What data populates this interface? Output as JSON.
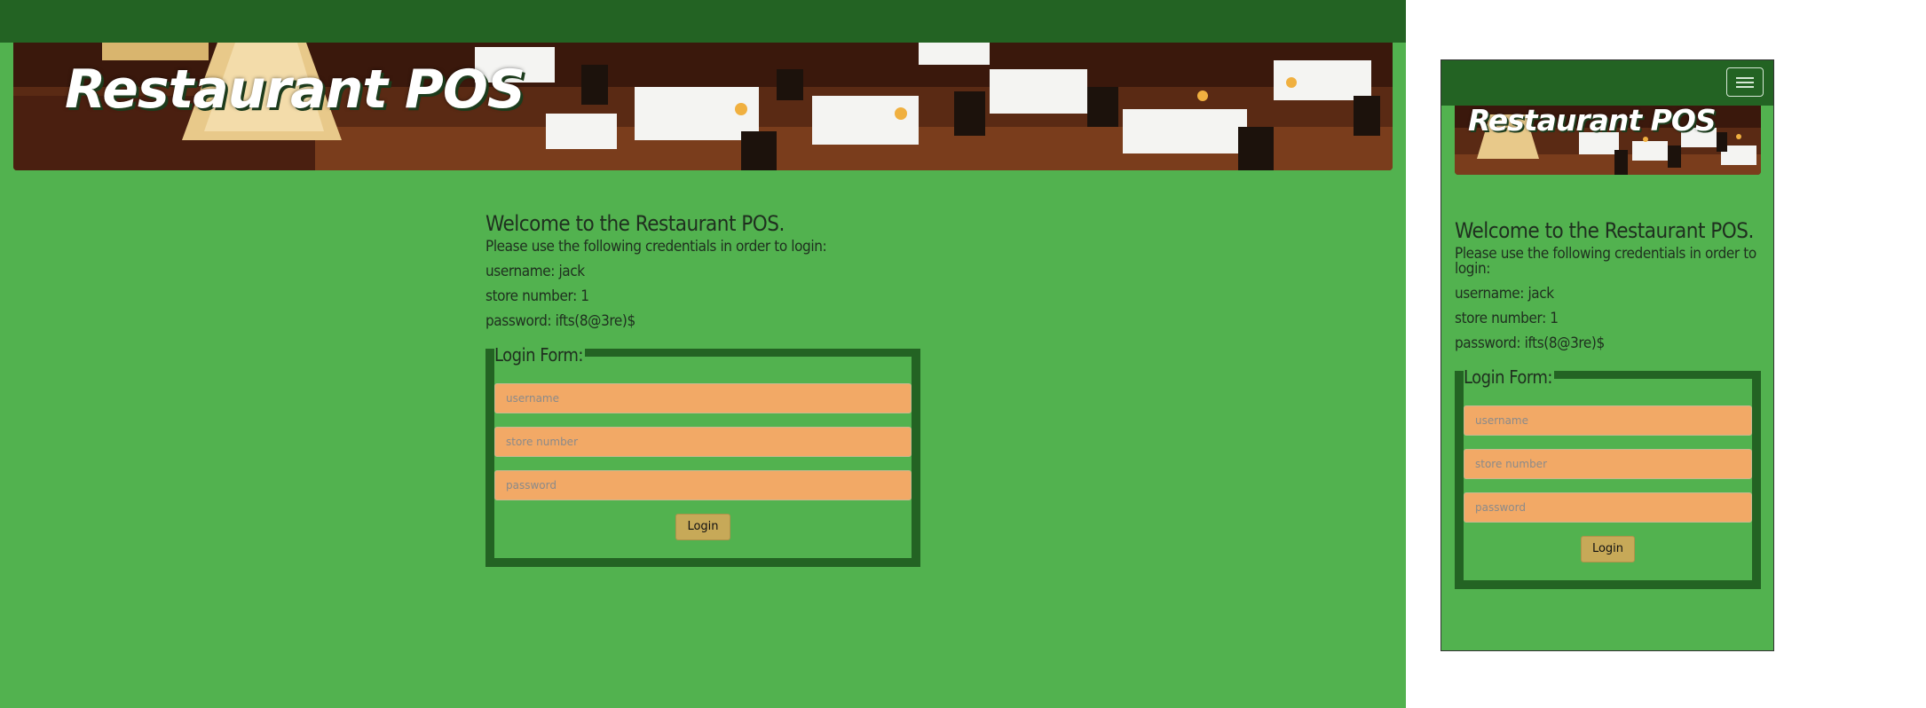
{
  "banner": {
    "title": "Restaurant POS"
  },
  "welcome": {
    "heading": "Welcome to the Restaurant POS.",
    "intro": "Please use the following credentials in order to login:",
    "username_line": "username: jack",
    "store_line": "store number: 1",
    "password_line": "password: ifts(8@3re)$"
  },
  "form": {
    "legend": "Login Form:",
    "username_placeholder": "username",
    "store_placeholder": "store number",
    "password_placeholder": "password",
    "login_label": "Login"
  },
  "colors": {
    "page_bg": "#52b24f",
    "nav_bg": "#236323",
    "input_bg": "#f2a966",
    "button_bg": "#c7a958"
  },
  "icons": {
    "menu": "hamburger-menu-icon"
  }
}
